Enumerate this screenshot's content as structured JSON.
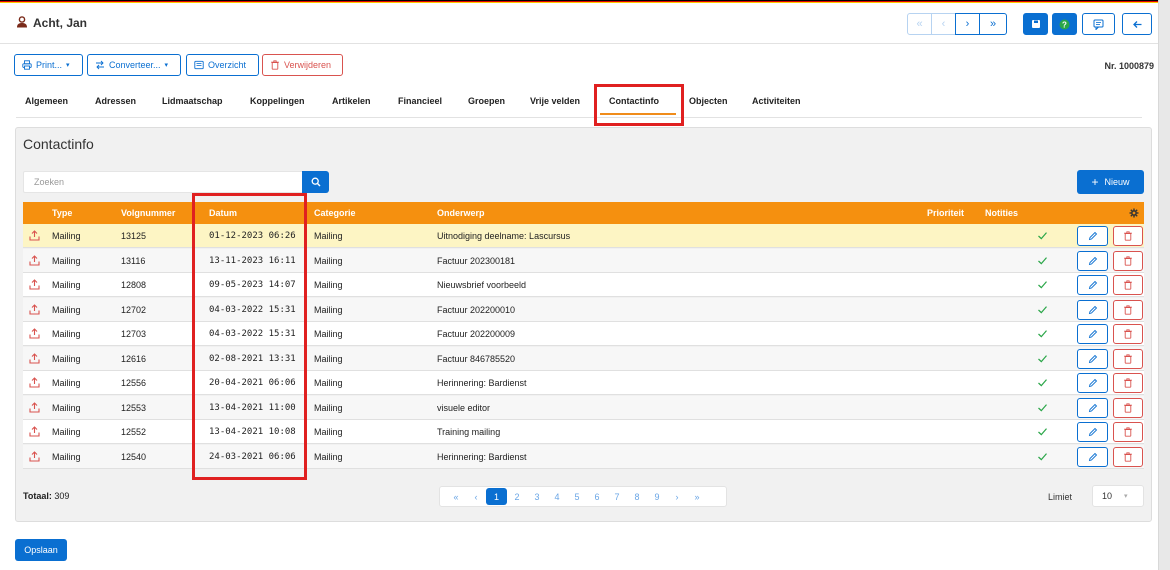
{
  "colors": {
    "primary": "#0a6fd1",
    "accent_orange": "#f5900f",
    "danger": "#d9534f",
    "highlight_row": "#fdf5c4",
    "annotation_red": "#e02020",
    "flag": [
      "#000000",
      "#dd0000",
      "#ffcc00"
    ]
  },
  "header": {
    "person_icon": "person-icon",
    "person_name": "Acht, Jan",
    "nav": [
      "«",
      "‹",
      "›",
      "»"
    ],
    "actions": [
      "save-icon",
      "help-icon",
      "comment-icon",
      "back-arrow-icon"
    ]
  },
  "toolbar": {
    "print_label": "Print...",
    "convert_label": "Converteer...",
    "overview_label": "Overzicht",
    "delete_label": "Verwijderen",
    "record_nr": "Nr. 1000879"
  },
  "tabs": [
    "Algemeen",
    "Adressen",
    "Lidmaatschap",
    "Koppelingen",
    "Artikelen",
    "Financieel",
    "Groepen",
    "Vrije velden",
    "Contactinfo",
    "Objecten",
    "Activiteiten"
  ],
  "active_tab": "Contactinfo",
  "panel": {
    "title": "Contactinfo",
    "search_placeholder": "Zoeken",
    "new_label": "Nieuw"
  },
  "table": {
    "columns": {
      "type": "Type",
      "volgnummer": "Volgnummer",
      "datum": "Datum",
      "categorie": "Categorie",
      "onderwerp": "Onderwerp",
      "prioriteit": "Prioriteit",
      "notities": "Notities",
      "settings_icon": "gear-icon"
    },
    "rows": [
      {
        "type": "Mailing",
        "volgnummer": "13125",
        "datum": "01-12-2023 06:26",
        "categorie": "Mailing",
        "onderwerp": "Uitnodiging deelname: Lascursus",
        "highlight": true
      },
      {
        "type": "Mailing",
        "volgnummer": "13116",
        "datum": "13-11-2023 16:11",
        "categorie": "Mailing",
        "onderwerp": "Factuur 202300181"
      },
      {
        "type": "Mailing",
        "volgnummer": "12808",
        "datum": "09-05-2023 14:07",
        "categorie": "Mailing",
        "onderwerp": "Nieuwsbrief voorbeeld"
      },
      {
        "type": "Mailing",
        "volgnummer": "12702",
        "datum": "04-03-2022 15:31",
        "categorie": "Mailing",
        "onderwerp": "Factuur 202200010"
      },
      {
        "type": "Mailing",
        "volgnummer": "12703",
        "datum": "04-03-2022 15:31",
        "categorie": "Mailing",
        "onderwerp": "Factuur 202200009"
      },
      {
        "type": "Mailing",
        "volgnummer": "12616",
        "datum": "02-08-2021 13:31",
        "categorie": "Mailing",
        "onderwerp": "Factuur 846785520"
      },
      {
        "type": "Mailing",
        "volgnummer": "12556",
        "datum": "20-04-2021 06:06",
        "categorie": "Mailing",
        "onderwerp": "Herinnering: Bardienst"
      },
      {
        "type": "Mailing",
        "volgnummer": "12553",
        "datum": "13-04-2021 11:00",
        "categorie": "Mailing",
        "onderwerp": "visuele editor"
      },
      {
        "type": "Mailing",
        "volgnummer": "12552",
        "datum": "13-04-2021 10:08",
        "categorie": "Mailing",
        "onderwerp": "Training mailing"
      },
      {
        "type": "Mailing",
        "volgnummer": "12540",
        "datum": "24-03-2021 06:06",
        "categorie": "Mailing",
        "onderwerp": "Herinnering: Bardienst"
      }
    ]
  },
  "footer": {
    "totaal_label": "Totaal:",
    "totaal_value": "309",
    "pagination": [
      "«",
      "‹",
      "1",
      "2",
      "3",
      "4",
      "5",
      "6",
      "7",
      "8",
      "9",
      "›",
      "»"
    ],
    "active_page": "1",
    "limiet_label": "Limiet",
    "limiet_value": "10",
    "save_label": "Opslaan"
  }
}
